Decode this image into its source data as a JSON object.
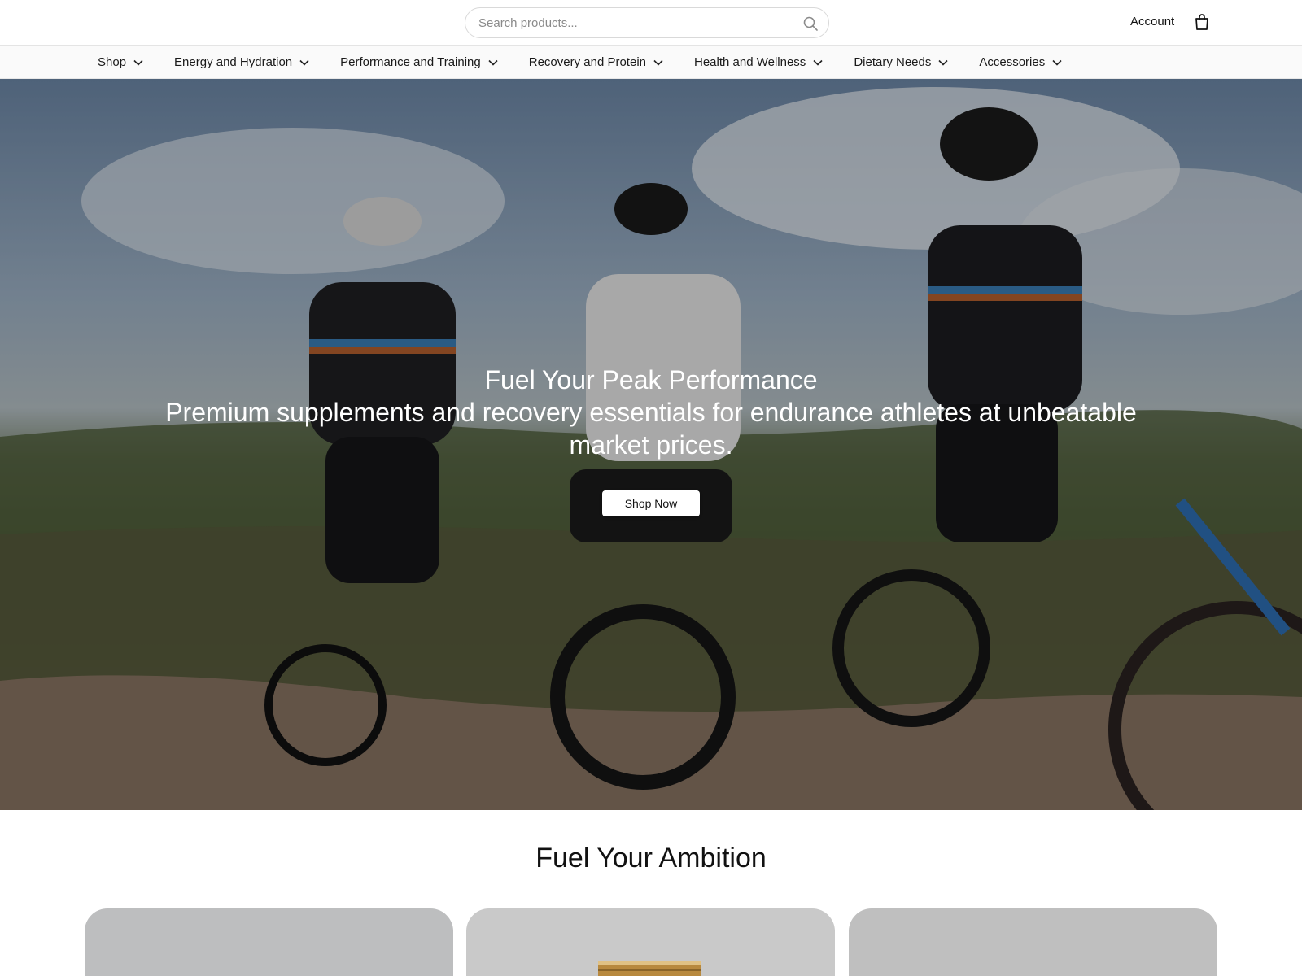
{
  "header": {
    "search_placeholder": "Search products...",
    "account_label": "Account"
  },
  "nav": {
    "items": [
      {
        "label": "Shop"
      },
      {
        "label": "Energy and Hydration"
      },
      {
        "label": "Performance and Training"
      },
      {
        "label": "Recovery and Protein"
      },
      {
        "label": "Health and Wellness"
      },
      {
        "label": "Dietary Needs"
      },
      {
        "label": "Accessories"
      }
    ]
  },
  "hero": {
    "title": "Fuel Your Peak Performance",
    "subtitle": "Premium supplements and recovery essentials for endurance athletes at unbeatable market prices.",
    "cta_label": "Shop Now"
  },
  "section": {
    "title": "Fuel Your Ambition"
  },
  "icons": {
    "search": "search-icon",
    "bag": "shopping-bag-icon",
    "chevron": "chevron-down-icon"
  },
  "colors": {
    "background": "#ffffff",
    "nav_background": "#fafafa",
    "text": "#111111",
    "hero_text": "#ffffff",
    "card_grey": "#c4c4c4"
  }
}
